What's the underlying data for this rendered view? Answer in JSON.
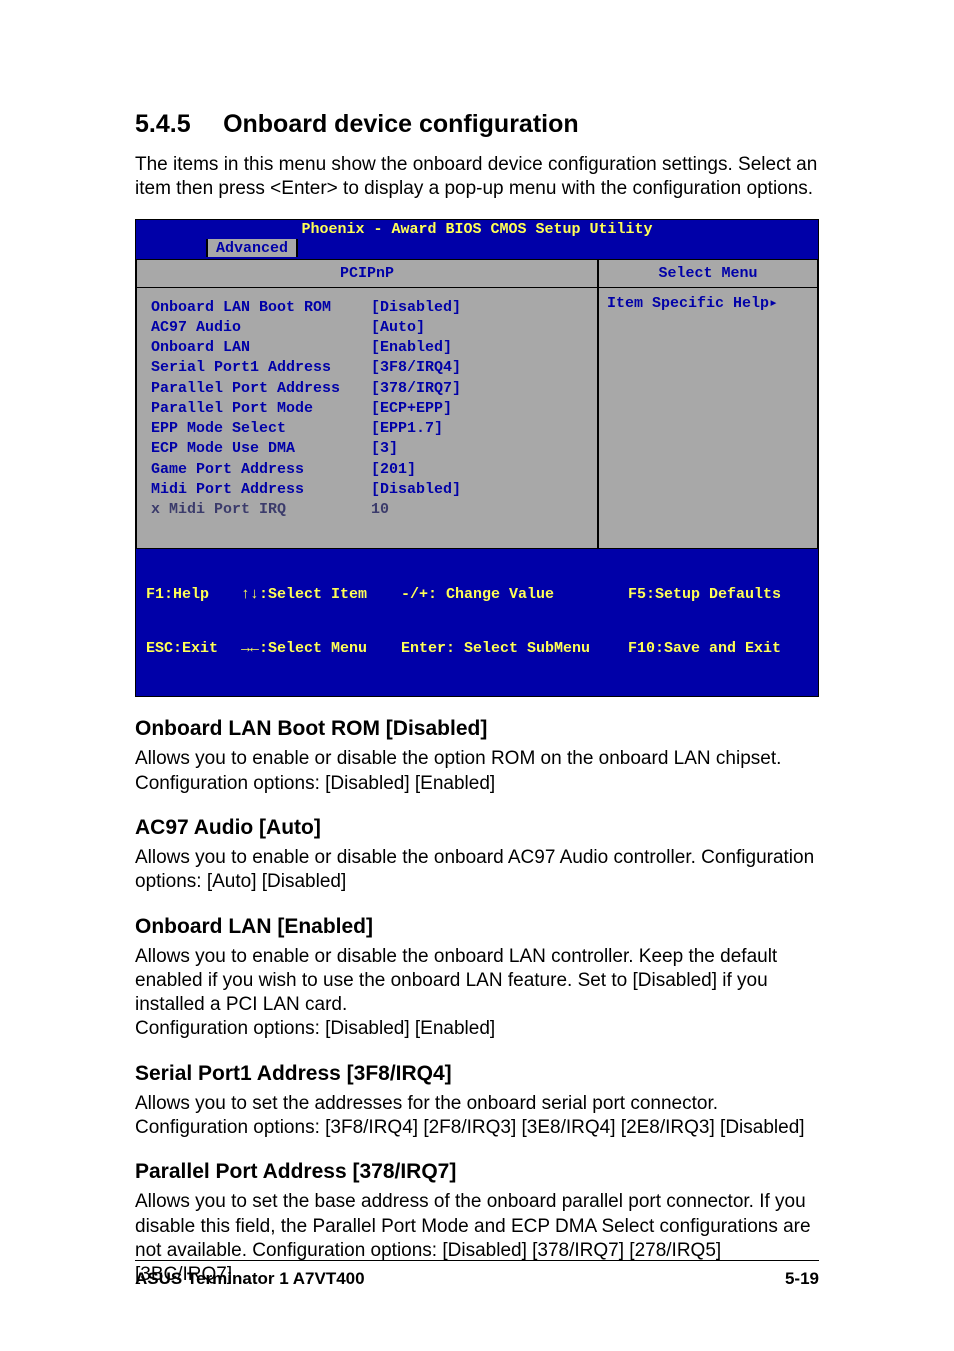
{
  "heading": {
    "number": "5.4.5",
    "title": "Onboard device configuration"
  },
  "intro": "The items in this menu show the onboard device configuration settings. Select an item then press <Enter> to display a pop-up menu with the configuration options.",
  "bios": {
    "title": "Phoenix - Award BIOS CMOS Setup Utility",
    "tab": "Advanced",
    "leftHeader": "PCIPnP",
    "rightHeader": "Select Menu",
    "rightBody": "Item Specific Help▸",
    "items": [
      {
        "label": "Onboard LAN Boot ROM",
        "value": "[Disabled]"
      },
      {
        "label": "AC97 Audio",
        "value": "[Auto]"
      },
      {
        "label": "Onboard LAN",
        "value": "[Enabled]"
      },
      {
        "label": "Serial Port1 Address",
        "value": "[3F8/IRQ4]"
      },
      {
        "label": "Parallel Port Address",
        "value": "[378/IRQ7]"
      },
      {
        "label": "Parallel Port Mode",
        "value": "[ECP+EPP]"
      },
      {
        "label": "EPP Mode Select",
        "value": "[EPP1.7]"
      },
      {
        "label": "ECP Mode Use DMA",
        "value": "[3]"
      },
      {
        "label": "Game Port Address",
        "value": "[201]"
      },
      {
        "label": "Midi Port Address",
        "value": "[Disabled]"
      }
    ],
    "disabledItem": {
      "label": "x Midi Port IRQ",
      "value": "10"
    },
    "footer": {
      "r1c1": "F1:Help",
      "r1c2": "↑↓:Select Item",
      "r1c3": "-/+: Change Value",
      "r1c4": "F5:Setup Defaults",
      "r2c1": "ESC:Exit",
      "r2c2": "→←:Select Menu",
      "r2c3": "Enter: Select SubMenu",
      "r2c4": "F10:Save and Exit"
    }
  },
  "sections": [
    {
      "title": "Onboard LAN Boot ROM [Disabled]",
      "body": "Allows you to enable or disable the option ROM on the onboard LAN chipset. Configuration options: [Disabled] [Enabled]"
    },
    {
      "title": "AC97 Audio [Auto]",
      "body": "Allows you to enable or disable the onboard AC97 Audio controller. Configuration options: [Auto] [Disabled]"
    },
    {
      "title": "Onboard LAN [Enabled]",
      "body": "Allows you to enable or disable the onboard LAN controller. Keep the default enabled if you wish to use the onboard LAN feature. Set to [Disabled] if you installed a PCI LAN card.\nConfiguration options: [Disabled] [Enabled]"
    },
    {
      "title": "Serial Port1 Address [3F8/IRQ4]",
      "body": "Allows you to set the addresses for the onboard serial port connector. Configuration options: [3F8/IRQ4] [2F8/IRQ3] [3E8/IRQ4] [2E8/IRQ3] [Disabled]"
    },
    {
      "title": "Parallel Port Address [378/IRQ7]",
      "body": "Allows you to set the base address of the onboard parallel port connector. If you disable this field, the Parallel Port Mode and ECP DMA Select configurations are not available. Configuration options: [Disabled] [378/IRQ7] [278/IRQ5] [3BC/IRQ7]"
    }
  ],
  "footer": {
    "left": "ASUS Terminator 1 A7VT400",
    "right": "5-19"
  }
}
